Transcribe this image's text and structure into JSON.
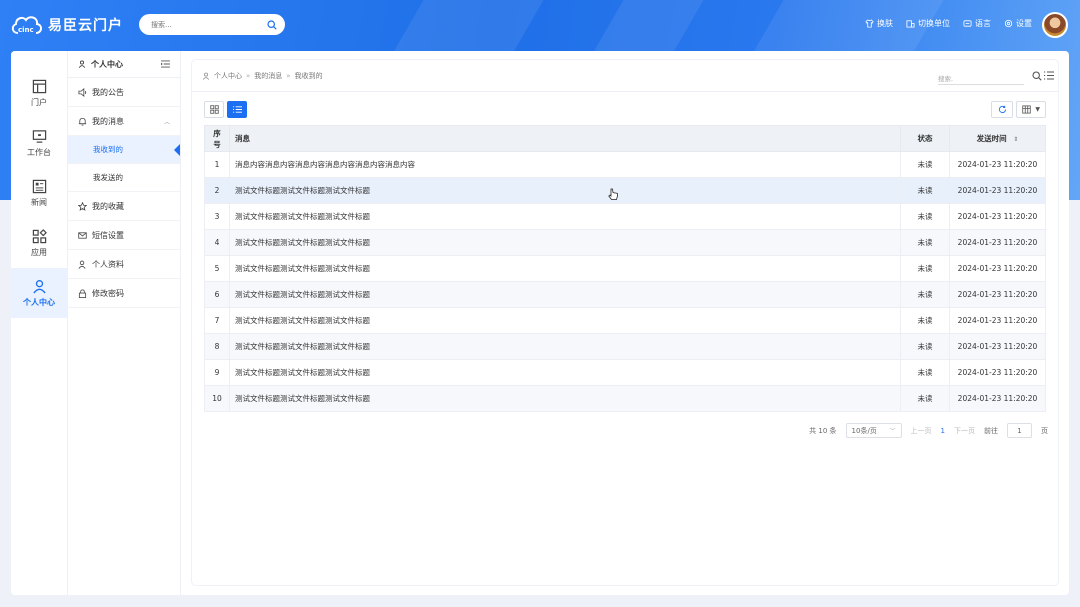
{
  "app": {
    "title": "易臣云门户",
    "logo_text": "cinc"
  },
  "search": {
    "placeholder": "搜索..."
  },
  "top_actions": [
    {
      "label": "换肤",
      "icon": "shirt-icon"
    },
    {
      "label": "切换单位",
      "icon": "building-icon"
    },
    {
      "label": "语言",
      "icon": "language-icon"
    },
    {
      "label": "设置",
      "icon": "gear-icon"
    }
  ],
  "leftnav": [
    {
      "label": "门户",
      "icon": "portal-icon"
    },
    {
      "label": "工作台",
      "icon": "monitor-icon"
    },
    {
      "label": "新闻",
      "icon": "news-icon"
    },
    {
      "label": "应用",
      "icon": "apps-icon"
    },
    {
      "label": "个人中心",
      "icon": "user-icon",
      "active": true
    }
  ],
  "submenu": {
    "title": "个人中心",
    "items": {
      "notice": "我的公告",
      "messages": "我的消息",
      "received": "我收到的",
      "sent": "我发送的",
      "favorites": "我的收藏",
      "sms": "短信设置",
      "profile": "个人资料",
      "password": "修改密码"
    }
  },
  "breadcrumb": [
    "个人中心",
    "我的消息",
    "我收到的"
  ],
  "content_search": {
    "placeholder": "搜索."
  },
  "table": {
    "headers": {
      "index": "序号",
      "message": "消息",
      "status": "状态",
      "time": "发送时间"
    },
    "rows": [
      {
        "index": "1",
        "message": "消息内容消息内容消息内容消息内容消息内容消息内容",
        "status": "未读",
        "time": "2024-01-23 11:20:20"
      },
      {
        "index": "2",
        "message": "测试文件标题测试文件标题测试文件标题",
        "status": "未读",
        "time": "2024-01-23 11:20:20"
      },
      {
        "index": "3",
        "message": "测试文件标题测试文件标题测试文件标题",
        "status": "未读",
        "time": "2024-01-23 11:20:20"
      },
      {
        "index": "4",
        "message": "测试文件标题测试文件标题测试文件标题",
        "status": "未读",
        "time": "2024-01-23 11:20:20"
      },
      {
        "index": "5",
        "message": "测试文件标题测试文件标题测试文件标题",
        "status": "未读",
        "time": "2024-01-23 11:20:20"
      },
      {
        "index": "6",
        "message": "测试文件标题测试文件标题测试文件标题",
        "status": "未读",
        "time": "2024-01-23 11:20:20"
      },
      {
        "index": "7",
        "message": "测试文件标题测试文件标题测试文件标题",
        "status": "未读",
        "time": "2024-01-23 11:20:20"
      },
      {
        "index": "8",
        "message": "测试文件标题测试文件标题测试文件标题",
        "status": "未读",
        "time": "2024-01-23 11:20:20"
      },
      {
        "index": "9",
        "message": "测试文件标题测试文件标题测试文件标题",
        "status": "未读",
        "time": "2024-01-23 11:20:20"
      },
      {
        "index": "10",
        "message": "测试文件标题测试文件标题测试文件标题",
        "status": "未读",
        "time": "2024-01-23 11:20:20"
      }
    ]
  },
  "pagination": {
    "total": "共 10 条",
    "page_size": "10条/页",
    "prev": "上一页",
    "current": "1",
    "next": "下一页",
    "goto_label": "前往",
    "goto_value": "1",
    "page_unit": "页"
  },
  "colors": {
    "accent": "#1c6ff0",
    "header": "#2f7ff5"
  }
}
